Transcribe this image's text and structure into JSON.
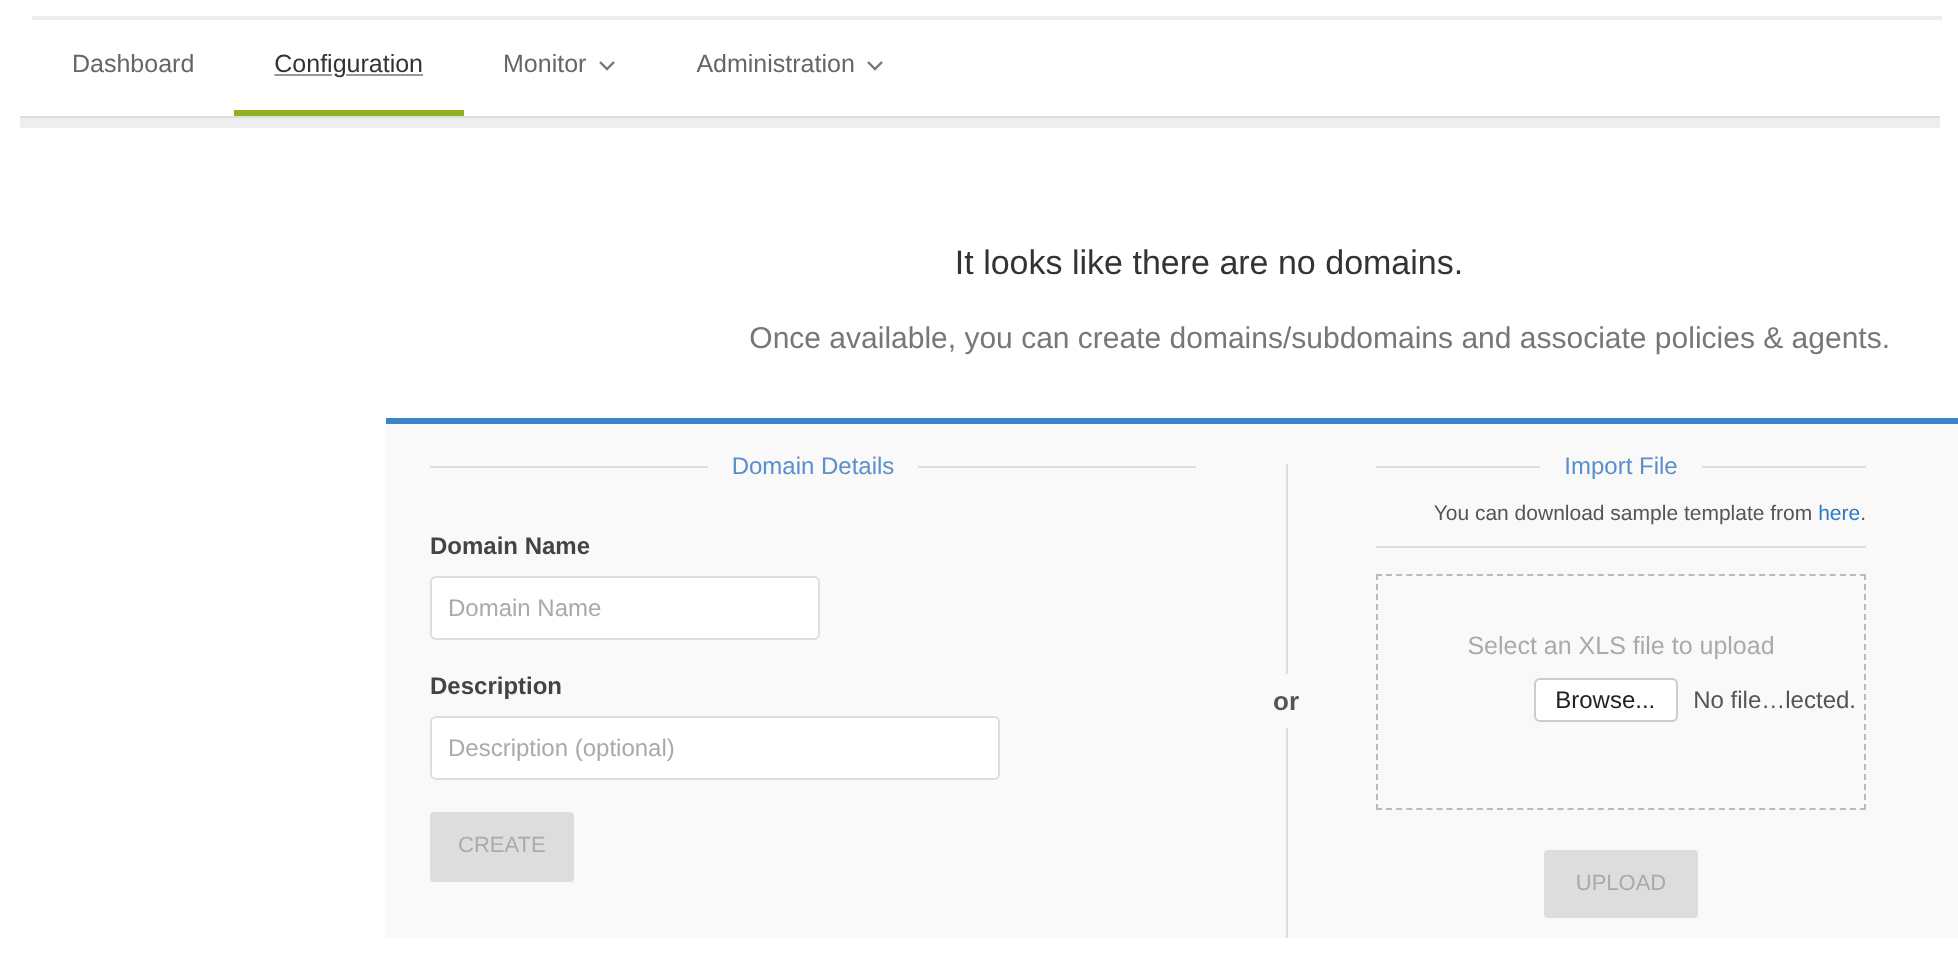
{
  "nav": {
    "tabs": [
      {
        "label": "Dashboard",
        "selected": false,
        "has_menu": false
      },
      {
        "label": "Configuration",
        "selected": true,
        "has_menu": false
      },
      {
        "label": "Monitor",
        "selected": false,
        "has_menu": true
      },
      {
        "label": "Administration",
        "selected": false,
        "has_menu": true
      }
    ]
  },
  "empty_state": {
    "title": "It looks like there are no domains.",
    "subtitle": "Once available, you can create domains/subdomains and associate policies & agents."
  },
  "domain_details": {
    "heading": "Domain Details",
    "fields": [
      {
        "label": "Domain Name",
        "placeholder": "Domain Name"
      },
      {
        "label": "Description",
        "placeholder": "Description (optional)"
      }
    ],
    "button": {
      "label": "CREATE",
      "disabled": true
    }
  },
  "separator": "or",
  "import_file": {
    "heading": "Import File",
    "note": "You can download sample template from ",
    "link": "here",
    "note_end": ".",
    "drop_label": "Select an XLS file to upload",
    "browse": "Browse...",
    "file_status": "No file…lected.",
    "button": {
      "label": "UPLOAD",
      "disabled": true
    }
  }
}
